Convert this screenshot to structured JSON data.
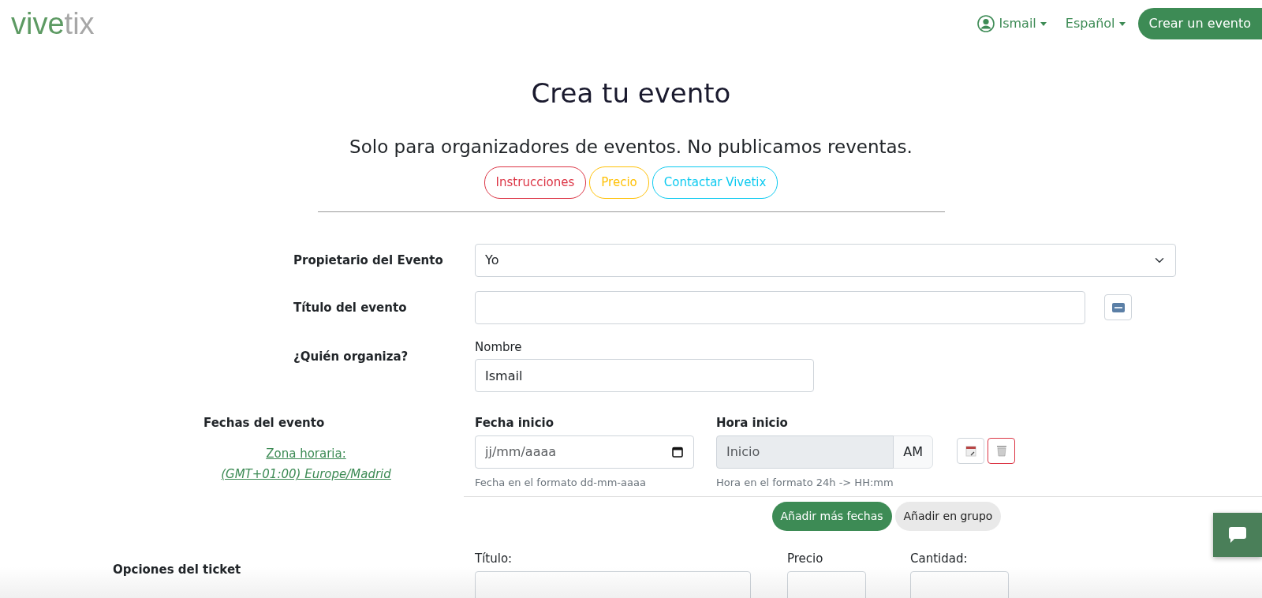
{
  "navbar": {
    "logo": {
      "first": "vive",
      "second": "tix"
    },
    "user_menu": "Ismail",
    "language_menu": "Español",
    "create_button": "Crear un evento"
  },
  "header": {
    "title": "Crea tu evento",
    "subtitle": "Solo para organizadores de eventos. No publicamos reventas.",
    "buttons": [
      {
        "label": "Instrucciones",
        "kind": "danger"
      },
      {
        "label": "Precio",
        "kind": "warning"
      },
      {
        "label": "Contactar Vivetix",
        "kind": "info"
      }
    ]
  },
  "form": {
    "owner": {
      "label": "Propietario del Evento",
      "value": "Yo"
    },
    "event_title": {
      "label": "Título del evento"
    },
    "organizer": {
      "label": "¿Quién organiza?",
      "name_label": "Nombre",
      "name_value": "Ismail"
    },
    "dates": {
      "label": "Fechas del evento",
      "timezone_link": "Zona horaria:",
      "timezone_value": "(GMT+01:00) Europe/Madrid",
      "start_date": {
        "label": "Fecha inicio",
        "placeholder": "jj/mm/aaaa",
        "help": "Fecha en el formato dd-mm-aaaa"
      },
      "start_time": {
        "label": "Hora inicio",
        "placeholder": "Inicio",
        "suffix": "AM",
        "help": "Hora en el formato 24h -> HH:mm",
        "disabled": true
      },
      "buttons": [
        {
          "label": "Añadir más fechas",
          "kind": "primary"
        },
        {
          "label": "Añadir en grupo",
          "kind": "secondary"
        }
      ]
    },
    "ticket_options": {
      "label": "Opciones del ticket",
      "columns": [
        "Título:",
        "Precio",
        "Cantidad:"
      ]
    }
  }
}
